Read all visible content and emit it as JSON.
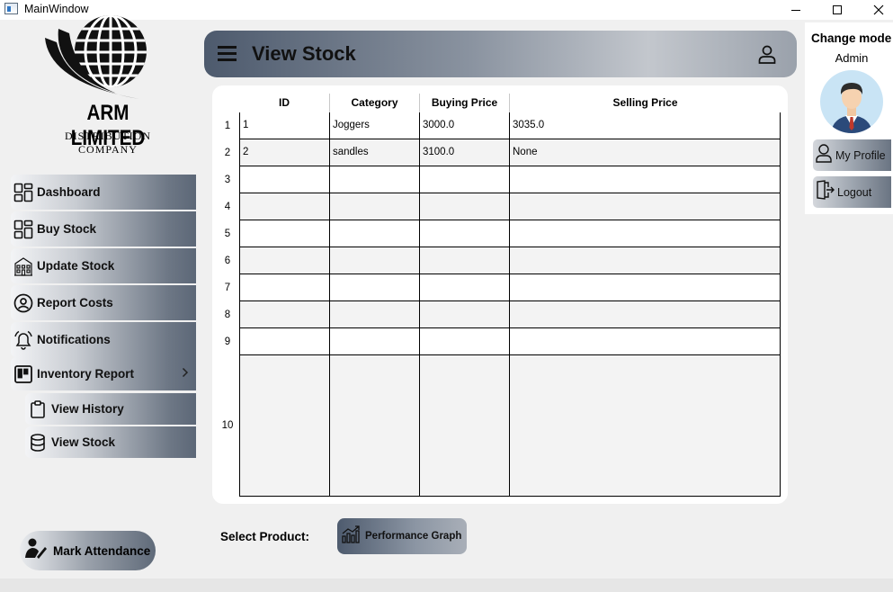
{
  "window": {
    "title": "MainWindow"
  },
  "logo": {
    "brand": "ARM LIMITED",
    "subtitle": "DISTRIBUTION COMPANY"
  },
  "sidebar": {
    "items": [
      {
        "label": "Dashboard",
        "icon": "dashboard-grid-icon"
      },
      {
        "label": "Buy Stock",
        "icon": "dashboard-grid-icon"
      },
      {
        "label": "Update Stock",
        "icon": "building-icon"
      },
      {
        "label": "Report Costs",
        "icon": "cost-report-icon"
      },
      {
        "label": "Notifications",
        "icon": "bell-icon"
      },
      {
        "label": "Inventory Report",
        "icon": "board-icon"
      }
    ],
    "subitems": [
      {
        "label": "View History",
        "icon": "clipboard-icon"
      },
      {
        "label": "View Stock",
        "icon": "database-icon"
      }
    ],
    "attendance_label": "Mark Attendance"
  },
  "header": {
    "title": "View Stock"
  },
  "table": {
    "columns": [
      "ID",
      "Category",
      "Buying Price",
      "Selling Price"
    ],
    "row_numbers": [
      "1",
      "2",
      "3",
      "4",
      "5",
      "6",
      "7",
      "8",
      "9",
      "10"
    ],
    "rows": [
      [
        "1",
        "Joggers",
        "3000.0",
        "3035.0"
      ],
      [
        "2",
        "sandles",
        "3100.0",
        "None"
      ],
      [
        "",
        "",
        "",
        ""
      ],
      [
        "",
        "",
        "",
        ""
      ],
      [
        "",
        "",
        "",
        ""
      ],
      [
        "",
        "",
        "",
        ""
      ],
      [
        "",
        "",
        "",
        ""
      ],
      [
        "",
        "",
        "",
        ""
      ],
      [
        "",
        "",
        "",
        ""
      ],
      [
        "",
        "",
        "",
        ""
      ]
    ]
  },
  "footer": {
    "select_label": "Select Product:",
    "performance_button": "Performance Graph"
  },
  "right_panel": {
    "change_mode": "Change mode",
    "role": "Admin",
    "profile_button": "My Profile",
    "logout_button": "Logout"
  },
  "colors": {
    "nav_gradient_dark": "#5c6777",
    "header_gradient_dark": "#4d5a6d"
  }
}
